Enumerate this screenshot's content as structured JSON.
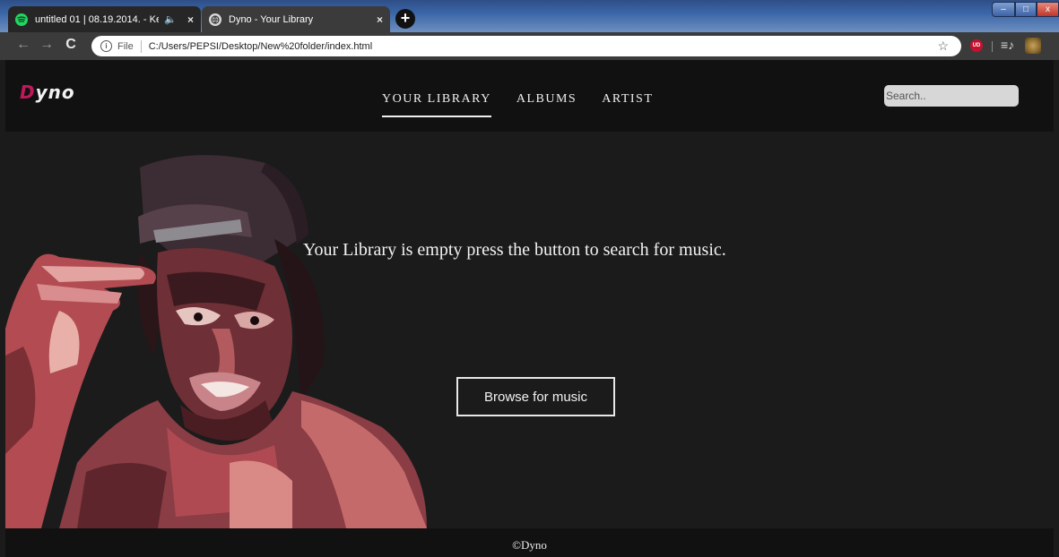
{
  "browser": {
    "tabs": [
      {
        "title": "untitled 01 | 08.19.2014. - Ker",
        "icon": "spotify-icon",
        "close": "×",
        "audio_icon": "🔈"
      },
      {
        "title": "Dyno - Your Library",
        "icon": "globe-icon",
        "close": "×"
      }
    ],
    "new_tab_label": "+",
    "address": {
      "info_icon": "i",
      "scheme_label": "File",
      "url": "C:/Users/PEPSI/Desktop/New%20folder/index.html"
    },
    "extension_badge": "UD"
  },
  "site": {
    "logo_initial": "D",
    "logo_rest": "yno",
    "nav": [
      {
        "label": "YOUR LIBRARY",
        "active": true
      },
      {
        "label": "ALBUMS",
        "active": false
      },
      {
        "label": "ARTIST",
        "active": false
      }
    ],
    "search": {
      "placeholder": "Search..",
      "value": ""
    },
    "empty_message": "Your Library is empty press the button to search for music.",
    "browse_label": "Browse for music",
    "footer": "©Dyno"
  },
  "colors": {
    "accent": "#c2185b",
    "page_bg": "#1b1b1b",
    "nav_bg": "#111111"
  }
}
